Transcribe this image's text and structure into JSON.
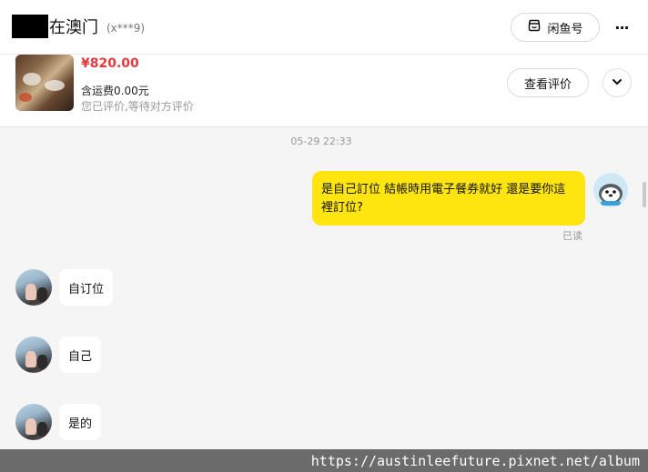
{
  "header": {
    "title": "在澳门",
    "user_id": "(x***9)",
    "xianyu_button": "闲鱼号",
    "more_label": "···"
  },
  "product": {
    "price": "¥820.00",
    "shipping": "含运费0.00元",
    "review_note": "您已评价,等待对方评价",
    "review_button": "查看评价"
  },
  "chat": {
    "timestamp": "05-29 22:33",
    "messages": [
      {
        "from": "me",
        "text": "是自己訂位 結帳時用電子餐券就好  還是要你這裡訂位?",
        "status": "已读"
      },
      {
        "from": "other",
        "text": "自订位"
      },
      {
        "from": "other",
        "text": "自己"
      },
      {
        "from": "other",
        "text": "是的"
      }
    ]
  },
  "watermark": "https://austinleefuture.pixnet.net/album",
  "colors": {
    "my_bubble": "#ffe50f",
    "price": "#e4393c",
    "watermark_bar": "#6b6b6b"
  },
  "icons": [
    "store-icon",
    "more-icon",
    "chevron-down-icon"
  ]
}
